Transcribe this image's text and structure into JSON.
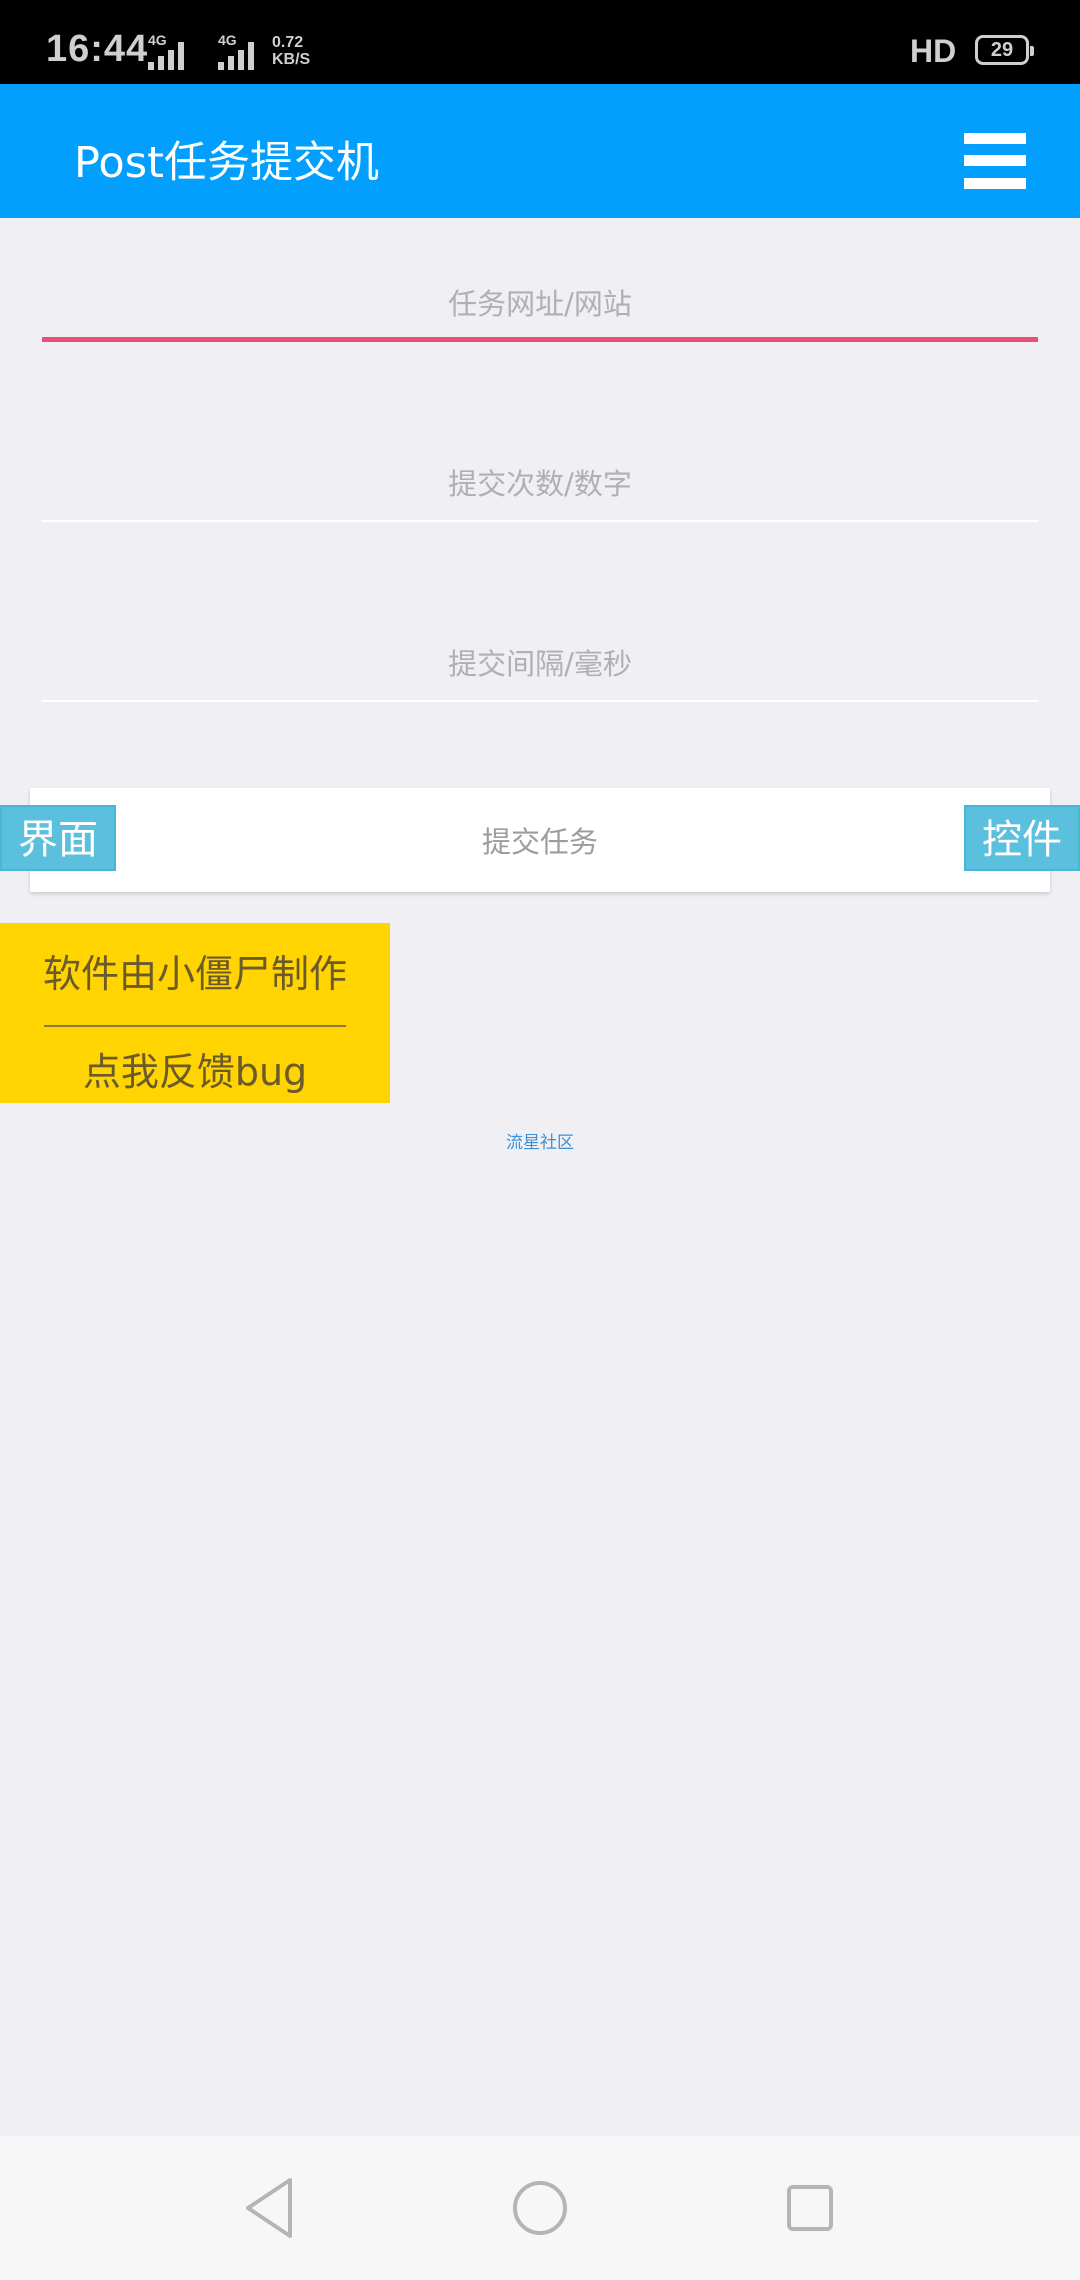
{
  "status_bar": {
    "time": "16:44",
    "signal_1_label": "4G",
    "signal_2_label": "4G",
    "net_speed_value": "0.72",
    "net_speed_unit": "KB/S",
    "hd_label": "HD",
    "battery_level": "29"
  },
  "app_bar": {
    "title": "Post任务提交机",
    "menu_icon": "hamburger-menu-icon",
    "background_color": "#039ffe"
  },
  "form": {
    "url_field": {
      "placeholder": "任务网址/网站",
      "value": ""
    },
    "count_field": {
      "placeholder": "提交次数/数字",
      "value": ""
    },
    "interval_field": {
      "placeholder": "提交间隔/毫秒",
      "value": ""
    },
    "submit_label": "提交任务"
  },
  "side_tags": {
    "left_label": "界面",
    "right_label": "控件",
    "color": "#5bc0de"
  },
  "credit": {
    "line1": "软件由小僵尸制作",
    "line2": "点我反馈bug",
    "color": "#ffd400"
  },
  "community_link": "流星社区",
  "nav_bar": {
    "back_icon": "back-triangle-icon",
    "home_icon": "home-circle-icon",
    "recents_icon": "recents-square-icon"
  },
  "colors": {
    "active_underline": "#ea4f7c",
    "page_background": "#efeff4"
  }
}
